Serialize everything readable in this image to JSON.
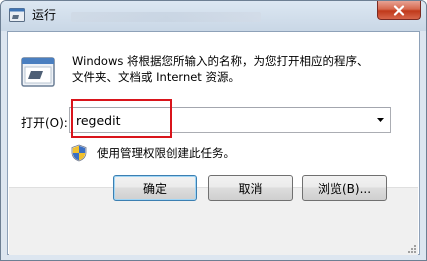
{
  "window": {
    "title": "运行",
    "close_icon": "close-icon",
    "app_icon": "run-app-icon"
  },
  "dialog": {
    "description": "Windows 将根据您所输入的名称，为您打开相应的程序、\n文件夹、文档或 Internet 资源。",
    "open_label": "打开(O):",
    "open_value": "regedit",
    "admin_note": "使用管理权限创建此任务。",
    "highlight_color": "#d9141b"
  },
  "buttons": {
    "ok": "确定",
    "cancel": "取消",
    "browse": "浏览(B)..."
  },
  "colors": {
    "accent": "#3c7fb1",
    "close_red": "#c0391b"
  }
}
